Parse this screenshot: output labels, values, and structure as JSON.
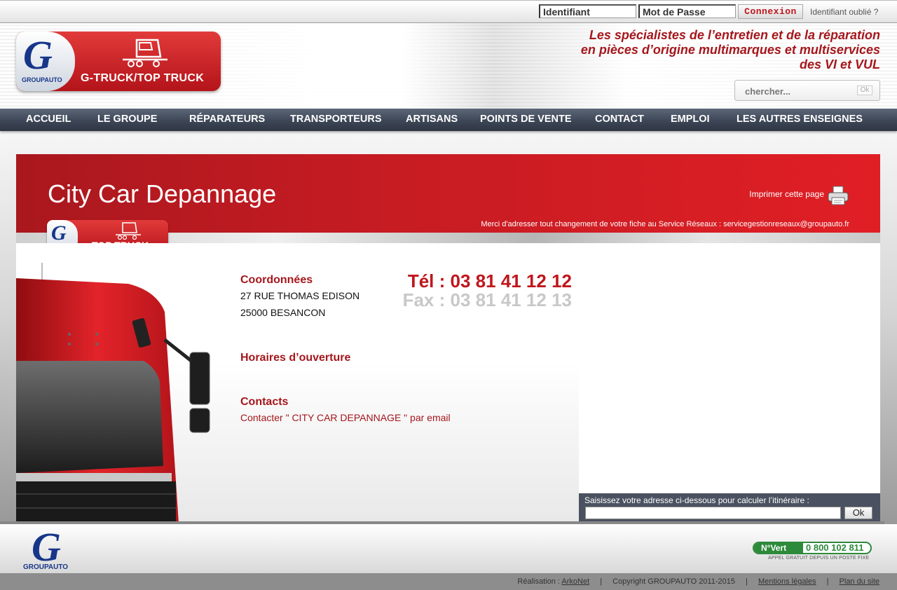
{
  "login": {
    "username_placeholder": "Identifiant",
    "password_placeholder": "Mot de Passe",
    "submit_label": "Connexion",
    "forgot_label": "Identifiant oublié ?"
  },
  "header": {
    "logo_text": "G-TRUCK/TOP TRUCK",
    "logo_sub": "GROUPAUTO",
    "tagline": [
      "Les spécialistes de l’entretien et de la réparation",
      "en pièces d’origine multimarques et multiservices",
      "des VI et VUL"
    ],
    "search_placeholder": "chercher...",
    "search_ok": "Ok"
  },
  "nav": [
    "ACCUEIL",
    "LE GROUPE",
    "RÉPARATEURS",
    "TRANSPORTEURS",
    "ARTISANS",
    "POINTS DE VENTE",
    "CONTACT",
    "EMPLOI",
    "LES AUTRES ENSEIGNES"
  ],
  "page": {
    "title": "City Car Depannage",
    "print_label": "Imprimer cette page",
    "notice": "Merci d'adresser tout changement de votre fiche au Service Réseaux : servicegestionreseaux@groupauto.fr",
    "badge_text": "TOP TRUCK",
    "coordonnees_title": "Coordonnées",
    "address_line1": "27 RUE THOMAS EDISON",
    "address_line2": "25000 BESANCON",
    "tel": "Tél : 03 81 41 12 12",
    "fax": "Fax : 03 81 41 12 13",
    "horaires_title": "Horaires d’ouverture",
    "contacts_title": "Contacts",
    "contact_link": "Contacter \" CITY CAR DEPANNAGE \" par email"
  },
  "route": {
    "label": "Saisissez votre adresse ci-dessous pour calculer l’itinéraire :",
    "ok": "Ok"
  },
  "footer": {
    "logo_text": "GROUPAUTO",
    "nvert_label": "N°Vert",
    "nvert_number": "0 800 102 811",
    "nvert_sub": "APPEL GRATUIT DEPUIS UN POSTE FIXE",
    "realisation_label": "Réalisation :",
    "realisation_link": "ArkoNet",
    "copyright": "Copyright GROUPAUTO 2011-2015",
    "mentions": "Mentions légales",
    "plan": "Plan du site"
  },
  "colors": {
    "brand_red": "#c0161c",
    "nav_dark": "#3d4656",
    "groupauto_blue": "#17368a"
  }
}
